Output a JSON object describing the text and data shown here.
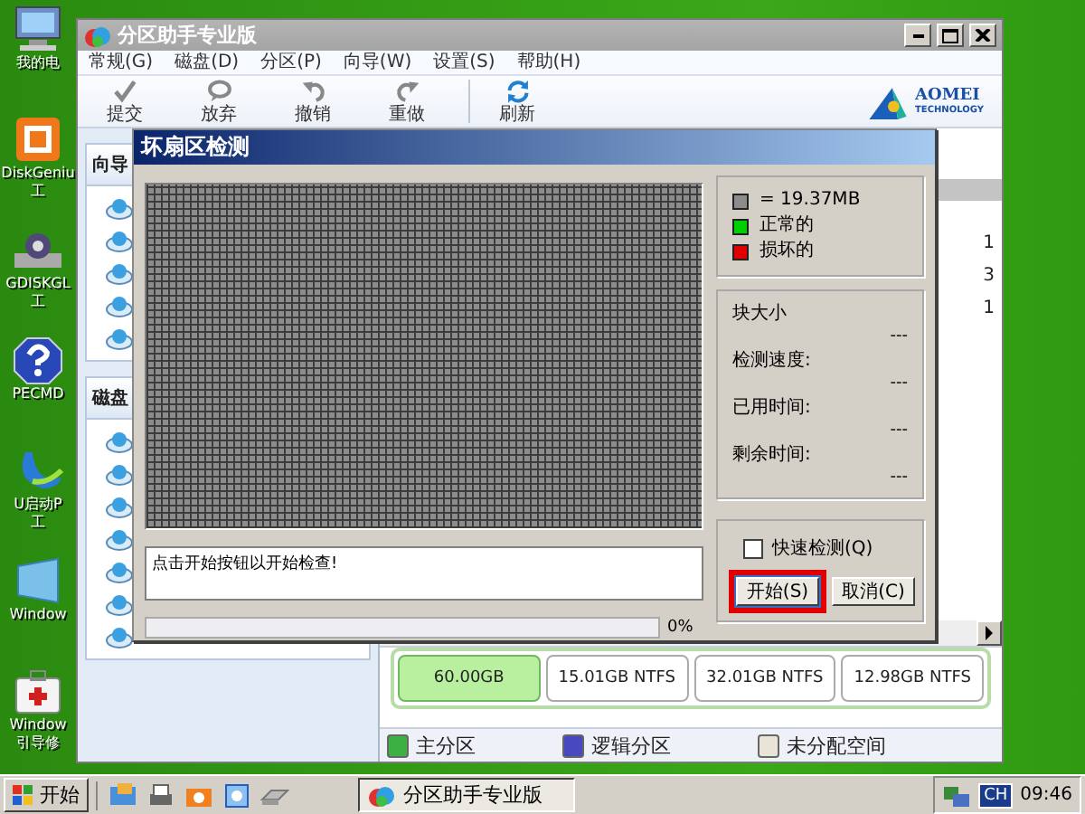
{
  "desktop_icons": [
    {
      "lines": [
        "我的电"
      ]
    },
    {
      "lines": [
        "DiskGeniu",
        "工"
      ]
    },
    {
      "lines": [
        "GDISKGL",
        "工"
      ]
    },
    {
      "lines": [
        "PECMD"
      ]
    },
    {
      "lines": [
        "U启动P",
        "工"
      ]
    },
    {
      "lines": [
        "Window"
      ]
    },
    {
      "lines": [
        "Window",
        "引导修"
      ]
    }
  ],
  "main_window": {
    "title": "分区助手专业版",
    "menu": [
      "常规(G)",
      "磁盘(D)",
      "分区(P)",
      "向导(W)",
      "设置(S)",
      "帮助(H)"
    ],
    "toolbar": [
      {
        "label": "提交"
      },
      {
        "label": "放弃"
      },
      {
        "label": "撤销"
      },
      {
        "label": "重做"
      },
      {
        "label": "刷新"
      }
    ],
    "logo": {
      "name": "AOMEI",
      "tagline": "TECHNOLOGY"
    },
    "sidebar": [
      {
        "title": "向导"
      },
      {
        "title": "磁盘"
      }
    ],
    "table_column": [
      "1",
      "3",
      "1"
    ],
    "disk_map": [
      {
        "label": "60.00GB",
        "selected": true
      },
      {
        "label": "15.01GB NTFS",
        "selected": false
      },
      {
        "label": "32.01GB NTFS",
        "selected": false
      },
      {
        "label": "12.98GB NTFS",
        "selected": false
      }
    ],
    "legend": [
      {
        "label": "主分区",
        "color": "#3cb043"
      },
      {
        "label": "逻辑分区",
        "color": "#4848c0"
      },
      {
        "label": "未分配空间",
        "color": "#e8e4d8"
      }
    ]
  },
  "dialog": {
    "title": "坏扇区检测",
    "legend": [
      {
        "label": "= 19.37MB",
        "color": "#8c8c8c"
      },
      {
        "label": "正常的",
        "color": "#00d000"
      },
      {
        "label": "损坏的",
        "color": "#e00000"
      }
    ],
    "stats": [
      {
        "label": "块大小",
        "value": "---"
      },
      {
        "label": "检测速度:",
        "value": "---"
      },
      {
        "label": "已用时间:",
        "value": "---"
      },
      {
        "label": "剩余时间:",
        "value": "---"
      }
    ],
    "log": "点击开始按钮以开始检查!",
    "progress": {
      "level": 0,
      "reading": "0%"
    },
    "quick_check": {
      "label": "快速检测(Q)",
      "checked": false
    },
    "buttons": [
      {
        "label": "开始(S)",
        "highlighted": true
      },
      {
        "label": "取消(C)",
        "highlighted": false
      }
    ]
  },
  "taskbar": {
    "start": "开始",
    "task": "分区助手专业版",
    "language": "CH",
    "clock": "09:46"
  }
}
